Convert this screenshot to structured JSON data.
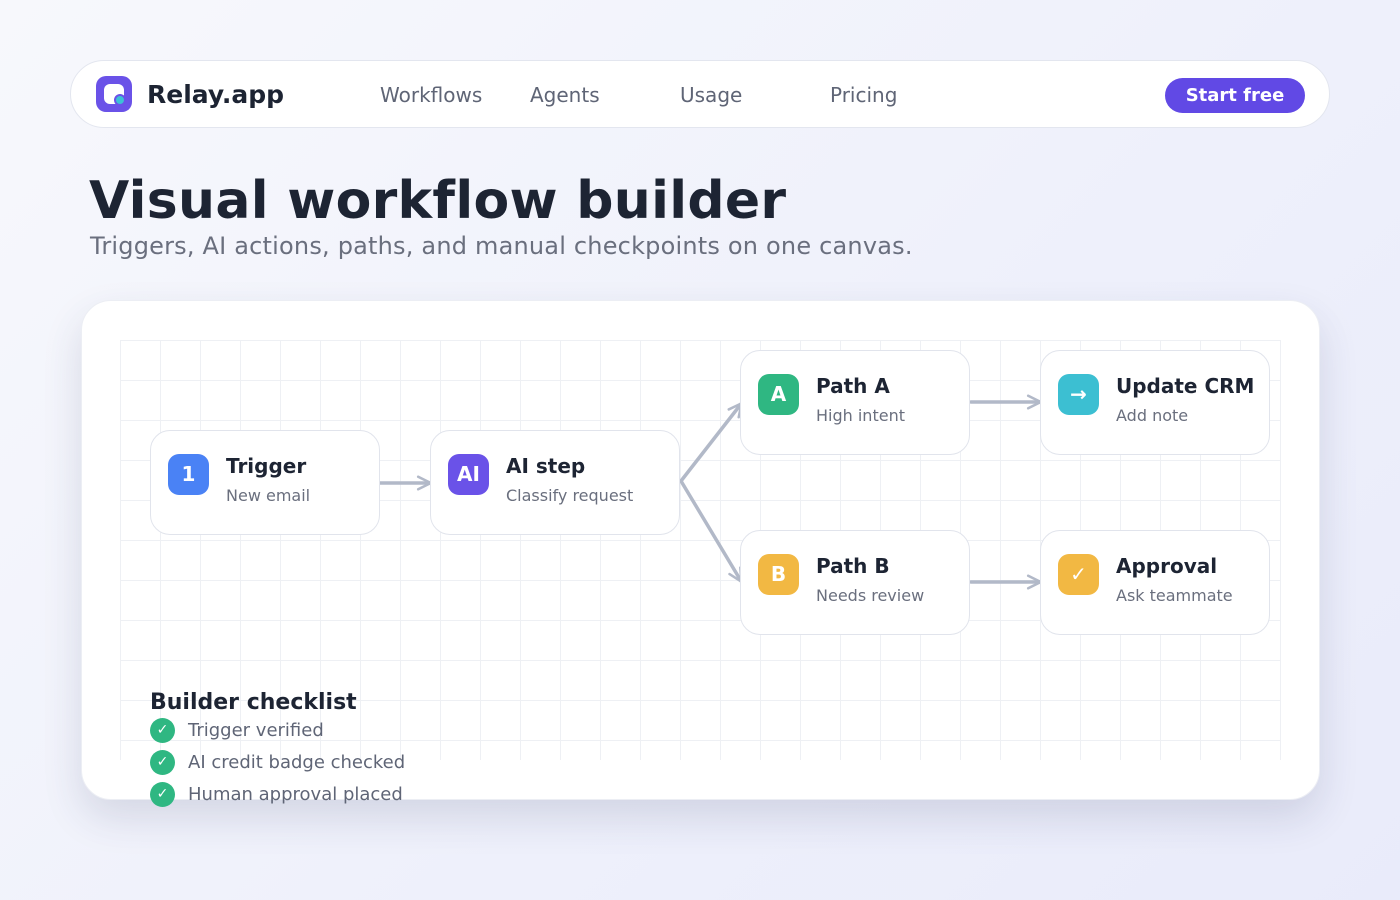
{
  "nav": {
    "brand": "Relay.app",
    "links": [
      "Workflows",
      "Agents",
      "Usage",
      "Pricing"
    ],
    "cta": "Start free"
  },
  "hero": {
    "title": "Visual workflow builder",
    "subtitle": "Triggers, AI actions, paths, and manual checkpoints on one canvas."
  },
  "nodes": [
    {
      "icon": "1",
      "icon_name": "step-number-icon",
      "color": "#4a82f5",
      "title": "Trigger",
      "subtitle": "New email"
    },
    {
      "icon": "AI",
      "icon_name": "ai-badge-icon",
      "color": "#6a52e8",
      "title": "AI step",
      "subtitle": "Classify request"
    },
    {
      "icon": "A",
      "icon_name": "path-a-icon",
      "color": "#2fb782",
      "title": "Path A",
      "subtitle": "High intent"
    },
    {
      "icon": "B",
      "icon_name": "path-b-icon",
      "color": "#f2b843",
      "title": "Path B",
      "subtitle": "Needs review"
    },
    {
      "icon": "→",
      "icon_name": "arrow-right-icon",
      "color": "#3cbfd2",
      "title": "Update CRM",
      "subtitle": "Add note"
    },
    {
      "icon": "✓",
      "icon_name": "checkmark-icon",
      "color": "#f2b843",
      "title": "Approval",
      "subtitle": "Ask teammate"
    }
  ],
  "checklist": {
    "title": "Builder checklist",
    "items": [
      "Trigger verified",
      "AI credit badge checked",
      "Human approval placed"
    ],
    "check_color": "#2fb782"
  },
  "colors": {
    "accent": "#6149e5",
    "connector": "#b2b9c8"
  }
}
